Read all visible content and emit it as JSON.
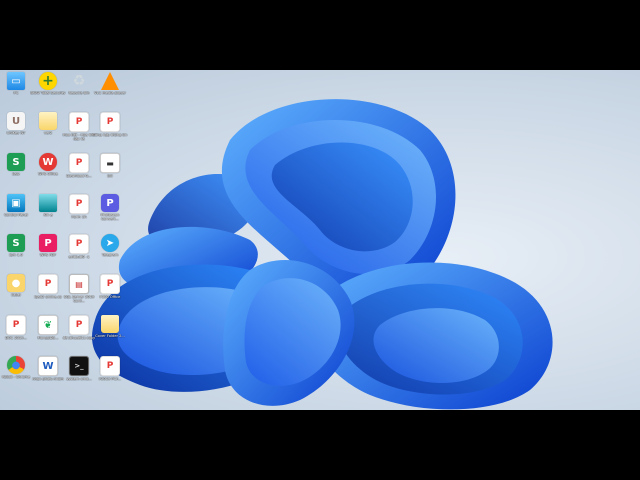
{
  "desktop": {
    "icons": [
      {
        "label": "PC",
        "icon": "computer-icon",
        "glyph": "▭",
        "cls": "g-pc",
        "col": 0,
        "row": 0
      },
      {
        "label": "BKAV Total Security",
        "icon": "bkav-icon",
        "glyph": "+",
        "cls": "g-bkav",
        "col": 1,
        "row": 0
      },
      {
        "label": "Recycle Bin",
        "icon": "recycle-bin-icon",
        "glyph": "♻",
        "cls": "g-bin",
        "col": 2,
        "row": 0
      },
      {
        "label": "VLC media player",
        "icon": "vlc-icon",
        "glyph": "",
        "cls": "g-vlc",
        "col": 3,
        "row": 0
      },
      {
        "label": "UniKey NT",
        "icon": "unikey-icon",
        "glyph": "U",
        "cls": "g-uni",
        "col": 0,
        "row": 1
      },
      {
        "label": "ver2",
        "icon": "folder-icon",
        "glyph": "",
        "cls": "g-folder",
        "col": 1,
        "row": 1
      },
      {
        "label": "Hoa tiết - Hoa tiết đặc tả",
        "icon": "pdf-icon",
        "glyph": "P",
        "cls": "g-pdf",
        "col": 2,
        "row": 1
      },
      {
        "label": "Tổng hợp thông tin",
        "icon": "pdf-icon",
        "glyph": "P",
        "cls": "g-pdf",
        "col": 3,
        "row": 1
      },
      {
        "label": "baiy",
        "icon": "spreadsheet-icon",
        "glyph": "S",
        "cls": "g-sheet",
        "col": 0,
        "row": 2
      },
      {
        "label": "WPS Office",
        "icon": "wps-office-icon",
        "glyph": "W",
        "cls": "g-wps",
        "col": 1,
        "row": 2
      },
      {
        "label": "Download G...",
        "icon": "pdf-icon",
        "glyph": "P",
        "cls": "g-pdf",
        "col": 2,
        "row": 2
      },
      {
        "label": "bill",
        "icon": "cash-icon",
        "glyph": "▬",
        "cls": "g-cash",
        "col": 3,
        "row": 2
      },
      {
        "label": "Control Panel",
        "icon": "control-panel-icon",
        "glyph": "▣",
        "cls": "g-monitor",
        "col": 0,
        "row": 3
      },
      {
        "label": "Xin ạ",
        "icon": "monitor-icon",
        "glyph": "",
        "cls": "g-mon2",
        "col": 1,
        "row": 3
      },
      {
        "label": "Form 1A",
        "icon": "pdf-icon",
        "glyph": "P",
        "cls": "g-pdf",
        "col": 2,
        "row": 3
      },
      {
        "label": "Photoscan Convert...",
        "icon": "photoscan-icon",
        "glyph": "P",
        "cls": "g-pscan",
        "col": 3,
        "row": 3
      },
      {
        "label": "lpm 1.0",
        "icon": "spreadsheet-icon",
        "glyph": "S",
        "cls": "g-sheet",
        "col": 0,
        "row": 4
      },
      {
        "label": "WPS PDF",
        "icon": "wps-pdf-icon",
        "glyph": "P",
        "cls": "g-wpspdf",
        "col": 1,
        "row": 4
      },
      {
        "label": "exitbutt0 -1",
        "icon": "pdf-icon",
        "glyph": "P",
        "cls": "g-pdf",
        "col": 2,
        "row": 4
      },
      {
        "label": "Telegram",
        "icon": "telegram-icon",
        "glyph": "➤",
        "cls": "g-tg",
        "col": 3,
        "row": 4
      },
      {
        "label": "Ilabel",
        "icon": "user-folder-icon",
        "glyph": "●",
        "cls": "g-user",
        "col": 0,
        "row": 5
      },
      {
        "label": "Ipad2 online.co",
        "icon": "pdf-icon",
        "glyph": "P",
        "cls": "g-pdf",
        "col": 1,
        "row": 5
      },
      {
        "label": "SQL Server 2019 Conf...",
        "icon": "database-icon",
        "glyph": "▤",
        "cls": "g-db",
        "col": 2,
        "row": 5
      },
      {
        "label": "P300 Office",
        "icon": "pdf-icon",
        "glyph": "P",
        "cls": "g-pdf",
        "col": 3,
        "row": 5
      },
      {
        "label": "DOC 2019...",
        "icon": "pdf-icon",
        "glyph": "P",
        "cls": "g-pdf",
        "col": 0,
        "row": 6
      },
      {
        "label": "MongoDB...",
        "icon": "mongodb-icon",
        "glyph": "❦",
        "cls": "g-mongo",
        "col": 1,
        "row": 6
      },
      {
        "label": "đề (thuyết1) copy",
        "icon": "pdf-icon",
        "glyph": "P",
        "cls": "g-pdf",
        "col": 2,
        "row": 6
      },
      {
        "label": "Cover Folder 2...",
        "icon": "folder-icon",
        "glyph": "",
        "cls": "g-folder",
        "col": 3,
        "row": 6
      },
      {
        "label": "Robot - Chrome",
        "icon": "chrome-icon",
        "glyph": "●",
        "cls": "g-chrome",
        "col": 0,
        "row": 7
      },
      {
        "label": "nhận phiếu nhóm",
        "icon": "word-icon",
        "glyph": "W",
        "cls": "g-word",
        "col": 1,
        "row": 7
      },
      {
        "label": "system cmd...",
        "icon": "terminal-icon",
        "glyph": ">_",
        "cls": "g-cmd",
        "col": 2,
        "row": 7
      },
      {
        "label": "P2019 PCF...",
        "icon": "pdf-icon",
        "glyph": "P",
        "cls": "g-pdf",
        "col": 3,
        "row": 7
      }
    ]
  }
}
